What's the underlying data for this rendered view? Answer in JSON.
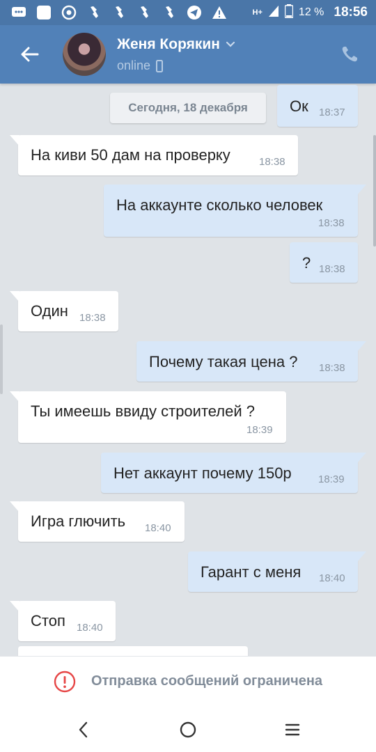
{
  "status_bar": {
    "battery_percent": "12 %",
    "time": "18:56",
    "network": "H+",
    "icons": [
      "chat-notification-icon",
      "app-notification-icon",
      "chrome-icon",
      "whatsapp-icon",
      "whatsapp-icon",
      "whatsapp-icon",
      "whatsapp-icon",
      "telegram-icon",
      "warning-icon",
      "signal-icon",
      "battery-icon"
    ]
  },
  "header": {
    "name": "Женя Корякин",
    "status": "online",
    "colors": {
      "bar": "#5181b8",
      "status_bar": "#4a76a8"
    }
  },
  "date_divider": "Сегодня, 18 декабря",
  "messages": [
    {
      "dir": "out",
      "text": "Ок",
      "time": "18:37"
    },
    {
      "dir": "in",
      "text": "На киви 50 дам на проверку",
      "time": "18:38"
    },
    {
      "dir": "out",
      "text": "На аккаунте сколько человек",
      "time": "18:38"
    },
    {
      "dir": "out",
      "text": "?",
      "time": "18:38"
    },
    {
      "dir": "in",
      "text": "Один",
      "time": "18:38"
    },
    {
      "dir": "out",
      "text": "Почему такая цена ?",
      "time": "18:38"
    },
    {
      "dir": "in",
      "text": "Ты имеешь ввиду строителей ?",
      "time": "18:39"
    },
    {
      "dir": "out",
      "text": "Нет аккаунт почему 150р",
      "time": "18:39"
    },
    {
      "dir": "in",
      "text": "Игра глючить",
      "time": "18:40"
    },
    {
      "dir": "out",
      "text": "Гарант с меня",
      "time": "18:40"
    },
    {
      "dir": "in",
      "text": "Стоп",
      "time": "18:40"
    }
  ],
  "restriction": {
    "text": "Отправка сообщений ограничена",
    "color": "#e64646"
  },
  "colors": {
    "incoming_bubble": "#ffffff",
    "outgoing_bubble": "#d8e7f8",
    "background": "#dfe3e7"
  }
}
